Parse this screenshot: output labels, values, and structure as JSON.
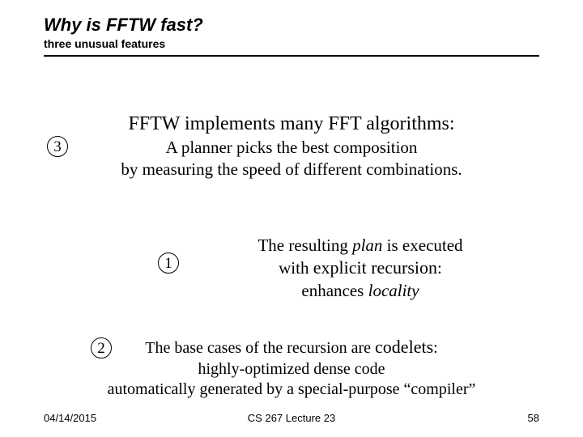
{
  "header": {
    "title": "Why is FFTW fast?",
    "subtitle": "three unusual features"
  },
  "badges": {
    "n1": "1",
    "n2": "2",
    "n3": "3"
  },
  "sec3": {
    "heading": "FFTW implements many FFT algorithms:",
    "line1": "A planner picks the best composition",
    "line2": "by measuring the speed of different combinations."
  },
  "sec1": {
    "l1_a": "The resulting ",
    "l1_plan": "plan",
    "l1_b": " is executed",
    "l2_a": "with ",
    "l2_explicit": "explicit ",
    "l2_recursion": "recursion",
    "l2_colon": ":",
    "l3_a": "enhances ",
    "l3_locality": "locality"
  },
  "sec2": {
    "l1_a": "The base cases of the recursion are ",
    "l1_codelets": "codelets",
    "l1_colon": ":",
    "l2": "highly-optimized dense code",
    "l3": "automatically generated by a special-purpose “compiler”"
  },
  "footer": {
    "date": "04/14/2015",
    "course": "CS 267 Lecture 23",
    "page": "58"
  }
}
